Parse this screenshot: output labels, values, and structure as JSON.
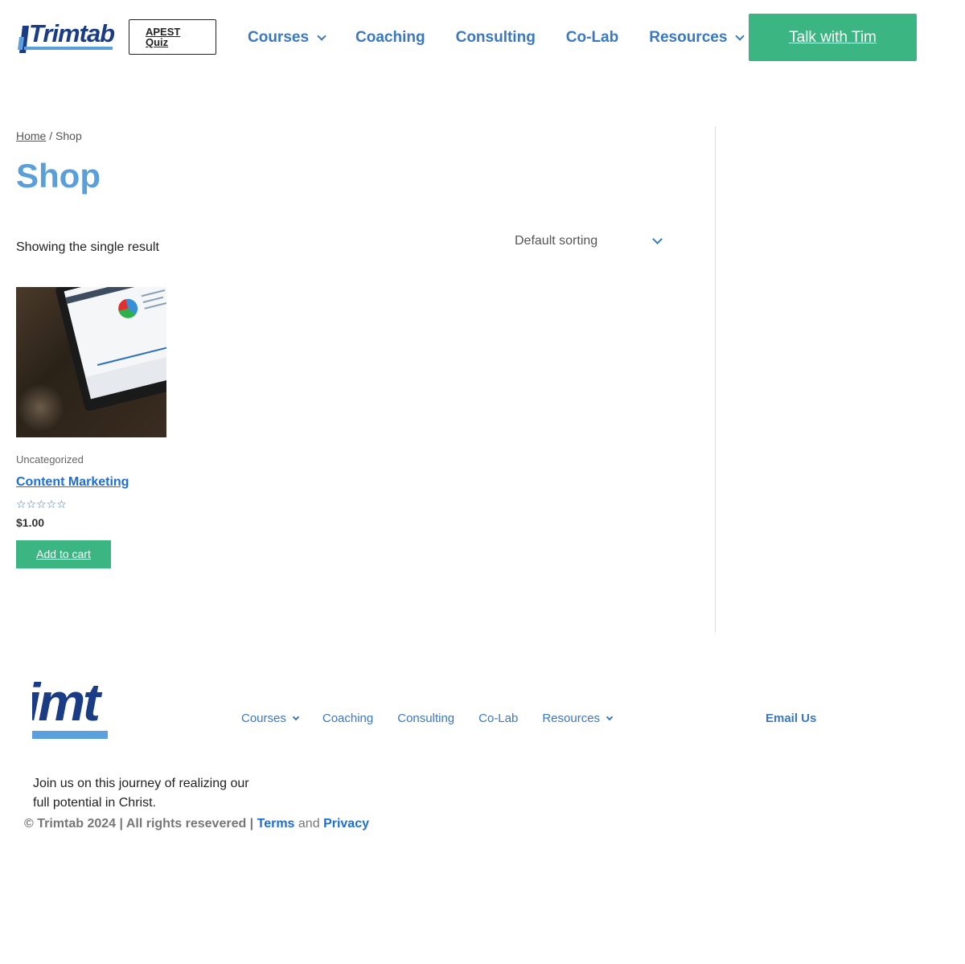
{
  "header": {
    "logo_text": "Trimtab",
    "quiz_label": "APEST Quiz",
    "nav": [
      {
        "label": "Courses",
        "has_dropdown": true
      },
      {
        "label": "Coaching",
        "has_dropdown": false
      },
      {
        "label": "Consulting",
        "has_dropdown": false
      },
      {
        "label": "Co-Lab",
        "has_dropdown": false
      },
      {
        "label": "Resources",
        "has_dropdown": true
      }
    ],
    "cta_label": "Talk with Tim"
  },
  "main": {
    "breadcrumb": {
      "home": "Home",
      "separator": "/",
      "current": "Shop"
    },
    "title": "Shop",
    "result_count": "Showing the single result",
    "sort": {
      "selected": "Default sorting"
    },
    "products": [
      {
        "category": "Uncategorized",
        "title": "Content Marketing",
        "rating_stars": "☆☆☆☆☆",
        "price": "$1.00",
        "cart_label": "Add to cart"
      }
    ]
  },
  "footer": {
    "logo_text": "imt",
    "nav": [
      {
        "label": "Courses",
        "has_dropdown": true
      },
      {
        "label": "Coaching",
        "has_dropdown": false
      },
      {
        "label": "Consulting",
        "has_dropdown": false
      },
      {
        "label": "Co-Lab",
        "has_dropdown": false
      },
      {
        "label": "Resources",
        "has_dropdown": true
      }
    ],
    "email_label": "Email Us",
    "tagline": "Join us on this journey of realizing our full potential in Christ.",
    "copyright": "© Trimtab 2024 | All rights resevered |",
    "terms": "Terms",
    "and": "and",
    "privacy": "Privacy"
  },
  "colors": {
    "brand_blue": "#1a3c85",
    "link_blue": "#3b78c0",
    "title_blue": "#5b9fda",
    "green": "#3bb581"
  }
}
